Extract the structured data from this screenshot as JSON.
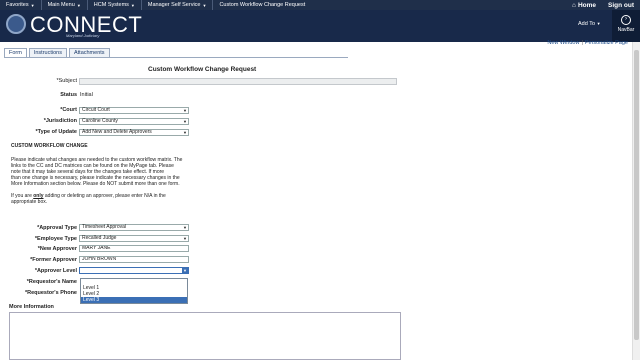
{
  "topnav": {
    "items": [
      "Favorites",
      "Main Menu",
      "HCM Systems",
      "Manager Self Service",
      "Custom Workflow Change Request"
    ],
    "home": "Home",
    "signout": "Sign out"
  },
  "banner": {
    "logo_text": "CONNECT",
    "logo_sub": "Maryland Judiciary",
    "add_to": "Add To",
    "navbar": "NavBar"
  },
  "util": {
    "new_window": "New Window",
    "sep": "|",
    "personalize": "Personalize Page"
  },
  "tabs": [
    "Form",
    "Instructions",
    "Attachments"
  ],
  "title": "Custom Workflow Change Request",
  "form": {
    "subject_label": "*Subject",
    "subject_value": "",
    "status_label": "Status",
    "status_value": "Initial",
    "court_label": "*Court",
    "court_value": "Circuit Court",
    "jurisdiction_label": "*Jurisdiction",
    "jurisdiction_value": "Caroline County",
    "type_label": "*Type of Update",
    "type_value": "Add New and Delete Approvers"
  },
  "section": {
    "heading": "CUSTOM WORKFLOW CHANGE",
    "para1": [
      "Please indicate what changes are needed to the custom workflow matrix. The",
      "links to the CC and DC matrices can be found on the MyPage tab.  Please",
      "note that it may take several days for the changes take effect.  If more",
      "than one change is necessary, please indicate the necessary changes in the",
      "More Information section below.  Please do NOT submit more than one form."
    ],
    "para2_a": "If you are ",
    "para2_only": "only",
    "para2_b": " adding or deleting an approver, please enter N/A in the",
    "para2_c": "appropriate box."
  },
  "approver": {
    "approval_type_label": "*Approval Type",
    "approval_type_value": "Timesheet Approval",
    "employee_type_label": "*Employee Type",
    "employee_type_value": "Recalled Judge",
    "new_approver_label": "*New Approver",
    "new_approver_value": "MARY JANE",
    "former_approver_label": "*Former Approver",
    "former_approver_value": "JOHN BROWN",
    "approver_level_label": "*Approver Level",
    "approver_level_value": "",
    "requestor_name_label": "*Requestor's Name",
    "requestor_phone_label": "*Requestor's Phone",
    "level_options": [
      "",
      "Level 1",
      "Level 2",
      "Level 3"
    ],
    "highlighted_option": "Level 3"
  },
  "more_info_label": "More Information"
}
